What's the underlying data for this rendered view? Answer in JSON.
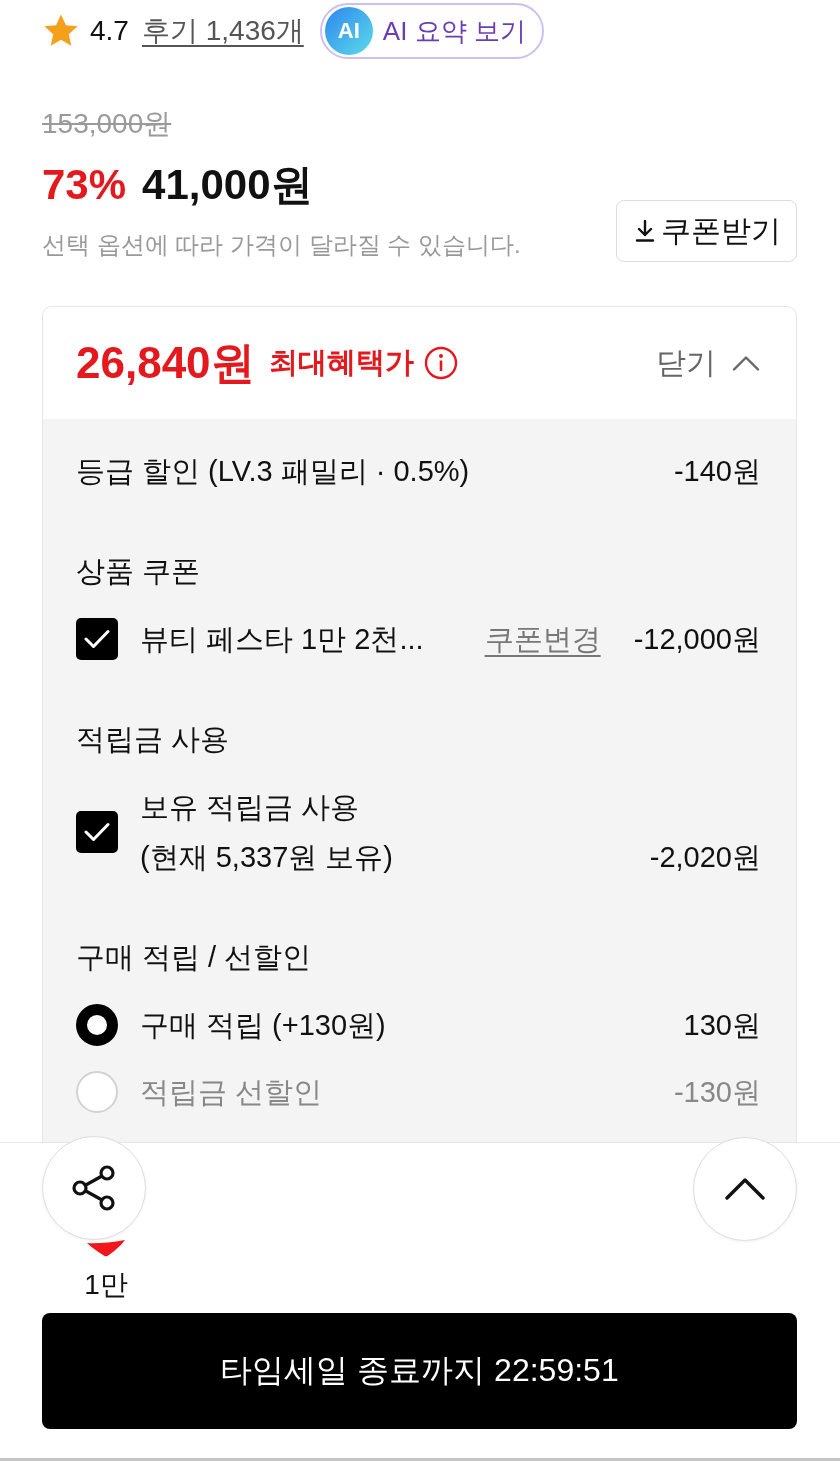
{
  "rating": {
    "score": "4.7",
    "reviews_link": "후기 1,436개"
  },
  "ai_summary_button": {
    "badge": "AI",
    "label": "AI 요약 보기"
  },
  "price": {
    "original": "153,000원",
    "discount_rate": "73%",
    "sale_price": "41,000원",
    "notice": "선택 옵션에 따라 가격이 달라질 수 있습니다.",
    "coupon_button": "쿠폰받기"
  },
  "benefit_panel": {
    "max_price": "26,840원",
    "max_label": "최대혜택가",
    "toggle_label": "닫기",
    "expanded": true,
    "items": [
      {
        "kind": "line",
        "label": "등급 할인 (LV.3 패밀리 · 0.5%)",
        "amount": "-140원"
      },
      {
        "kind": "heading",
        "label": "상품 쿠폰"
      },
      {
        "kind": "checkbox",
        "label": "뷰티 페스타 1만 2천...",
        "link": "쿠폰변경",
        "amount": "-12,000원",
        "checked": true
      },
      {
        "kind": "heading",
        "label": "적립금 사용"
      },
      {
        "kind": "checkbox",
        "label": "보유 적립금 사용",
        "sublabel": "(현재 5,337원 보유)",
        "amount": "-2,020원",
        "checked": true
      },
      {
        "kind": "heading",
        "label": "구매 적립 / 선할인"
      },
      {
        "kind": "radio",
        "label": "구매 적립 (+130원)",
        "amount": "130원",
        "selected": true
      },
      {
        "kind": "radio",
        "label": "적립금 선할인",
        "amount": "-130원",
        "selected": false
      }
    ]
  },
  "like": {
    "liked": true,
    "count": "1만"
  },
  "timesale_button": {
    "label": "타임세일 종료까지 22:59:51"
  }
}
